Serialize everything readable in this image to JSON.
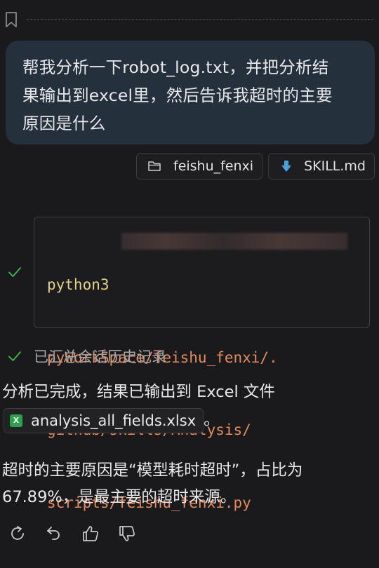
{
  "user_message": {
    "lines": [
      "帮我分析一下robot_log.txt，并把分析结",
      "果输出到excel里，然后告诉我超时的主要",
      "原因是什么"
    ]
  },
  "attachments": [
    {
      "icon": "folder-icon",
      "label": "feishu_fenxi"
    },
    {
      "icon": "download-arrow-icon",
      "label": "SKILL.md"
    }
  ],
  "tool_call": {
    "status_icon": "check-icon",
    "command": "python3",
    "path_lines": [
      "pyWorkSpace/feishu_fenxi/.",
      "github/skills/Analysis/",
      "scripts/feishu_fenxi.py"
    ]
  },
  "status": {
    "icon": "check-icon",
    "text": "已汇总会话历史记录"
  },
  "response": {
    "line1": "分析已完成，结果已输出到 Excel 文件",
    "file_label": "analysis_all_fields.xlsx",
    "file_icon_text": "X",
    "line1_end": "。",
    "para2_lines": [
      "超时的主要原因是“模型耗时超时”，占比为",
      "67.89%，是最主要的超时来源。"
    ]
  },
  "colors": {
    "background": "#1a1a1c",
    "user_bubble": "#24303c",
    "code_command": "#dfd18a",
    "code_path": "#e28b5e",
    "check": "#3fb950",
    "excel_green": "#2e9e4f",
    "download_blue": "#4aa3df"
  }
}
